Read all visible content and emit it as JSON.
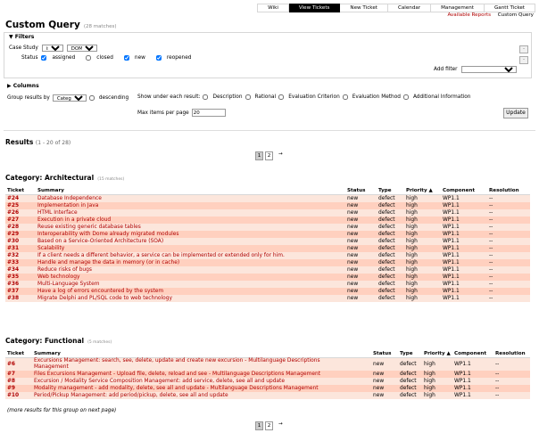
{
  "nav": {
    "tabs": [
      {
        "label": "Wiki",
        "active": false
      },
      {
        "label": "View Tickets",
        "active": true
      },
      {
        "label": "New Ticket",
        "active": false
      },
      {
        "label": "Calendar",
        "active": false
      },
      {
        "label": "Management",
        "active": false
      },
      {
        "label": "Gantt Ticket",
        "active": false
      }
    ],
    "sub": {
      "reports": "Available Reports",
      "custom": "Custom Query"
    }
  },
  "title": "Custom Query",
  "title_count": "(28 matches)",
  "filters": {
    "legend": "▼ Filters",
    "case_label": "Case Study",
    "case_op": "is",
    "case_value": "DOME",
    "status_label": "Status",
    "status": [
      {
        "label": "assigned",
        "checked": true
      },
      {
        "label": "closed",
        "checked": false
      },
      {
        "label": "new",
        "checked": true
      },
      {
        "label": "reopened",
        "checked": true
      }
    ],
    "add_filter_label": "Add filter"
  },
  "columns_label": "▶ Columns",
  "group": {
    "label": "Group results by",
    "value": "Category",
    "descending": "descending"
  },
  "show": {
    "label": "Show under each result:",
    "items": [
      "Description",
      "Rational",
      "Evaluation Criterion",
      "Evaluation Method",
      "Additional Information"
    ]
  },
  "max": {
    "label": "Max items per page",
    "value": "20"
  },
  "update_label": "Update",
  "results": {
    "label": "Results",
    "range": "(1 - 20 of 28)"
  },
  "pager": {
    "pages": [
      "1",
      "2"
    ],
    "next": "→"
  },
  "headers1": [
    "Ticket",
    "Summary",
    "Status",
    "Type",
    "Priority ▲",
    "Component",
    "Resolution"
  ],
  "headers2": [
    "Ticket",
    "Summary",
    "Status",
    "Type",
    "Priority ▲",
    "Component",
    "Resolution"
  ],
  "groups": [
    {
      "title": "Category: Architectural",
      "count": "(15 matches)",
      "rows": [
        [
          "#24",
          "Database Independence",
          "new",
          "defect",
          "high",
          "WP1.1",
          "--"
        ],
        [
          "#25",
          "Implementation in Java",
          "new",
          "defect",
          "high",
          "WP1.1",
          "--"
        ],
        [
          "#26",
          "HTML Interface",
          "new",
          "defect",
          "high",
          "WP1.1",
          "--"
        ],
        [
          "#27",
          "Execution in a private cloud",
          "new",
          "defect",
          "high",
          "WP1.1",
          "--"
        ],
        [
          "#28",
          "Reuse existing generic database tables",
          "new",
          "defect",
          "high",
          "WP1.1",
          "--"
        ],
        [
          "#29",
          "Interoperability with Dome already migrated modules",
          "new",
          "defect",
          "high",
          "WP1.1",
          "--"
        ],
        [
          "#30",
          "Based on a Service-Oriented Architecture (SOA)",
          "new",
          "defect",
          "high",
          "WP1.1",
          "--"
        ],
        [
          "#31",
          "Scalability",
          "new",
          "defect",
          "high",
          "WP1.1",
          "--"
        ],
        [
          "#32",
          "If a client needs a different behavior, a service can be implemented or extended only for him.",
          "new",
          "defect",
          "high",
          "WP1.1",
          "--"
        ],
        [
          "#33",
          "Handle and manage the data in memory (or in cache)",
          "new",
          "defect",
          "high",
          "WP1.1",
          "--"
        ],
        [
          "#34",
          "Reduce risks of bugs",
          "new",
          "defect",
          "high",
          "WP1.1",
          "--"
        ],
        [
          "#35",
          "Web technology",
          "new",
          "defect",
          "high",
          "WP1.1",
          "--"
        ],
        [
          "#36",
          "Multi-Language System",
          "new",
          "defect",
          "high",
          "WP1.1",
          "--"
        ],
        [
          "#37",
          "Have a log of errors encountered by the system",
          "new",
          "defect",
          "high",
          "WP1.1",
          "--"
        ],
        [
          "#38",
          "Migrate Delphi and PL/SQL code to web technology",
          "new",
          "defect",
          "high",
          "WP1.1",
          "--"
        ]
      ]
    },
    {
      "title": "Category: Functional",
      "count": "(5 matches)",
      "rows": [
        [
          "#6",
          "Excursions Management: search, see, delete, update and create new excursion - Multilanguage Descriptions|Management",
          "new",
          "defect",
          "high",
          "WP1.1",
          "--"
        ],
        [
          "#7",
          "Files Excursions Management - Upload file, delete, reload and see - Multilanguage Descriptions Management",
          "new",
          "defect",
          "high",
          "WP1.1",
          "--"
        ],
        [
          "#8",
          "Excursion / Modality Service Composition Management: add service, delete, see all and update",
          "new",
          "defect",
          "high",
          "WP1.1",
          "--"
        ],
        [
          "#9",
          "Modality management - add modality, delete, see all and update - Multilanguage Descriptions Management",
          "new",
          "defect",
          "high",
          "WP1.1",
          "--"
        ],
        [
          "#10",
          "Period/Pickup Management: add period/pickup, delete, see all and update",
          "new",
          "defect",
          "high",
          "WP1.1",
          "--"
        ]
      ]
    }
  ],
  "more": "(more results for this group on next page)"
}
